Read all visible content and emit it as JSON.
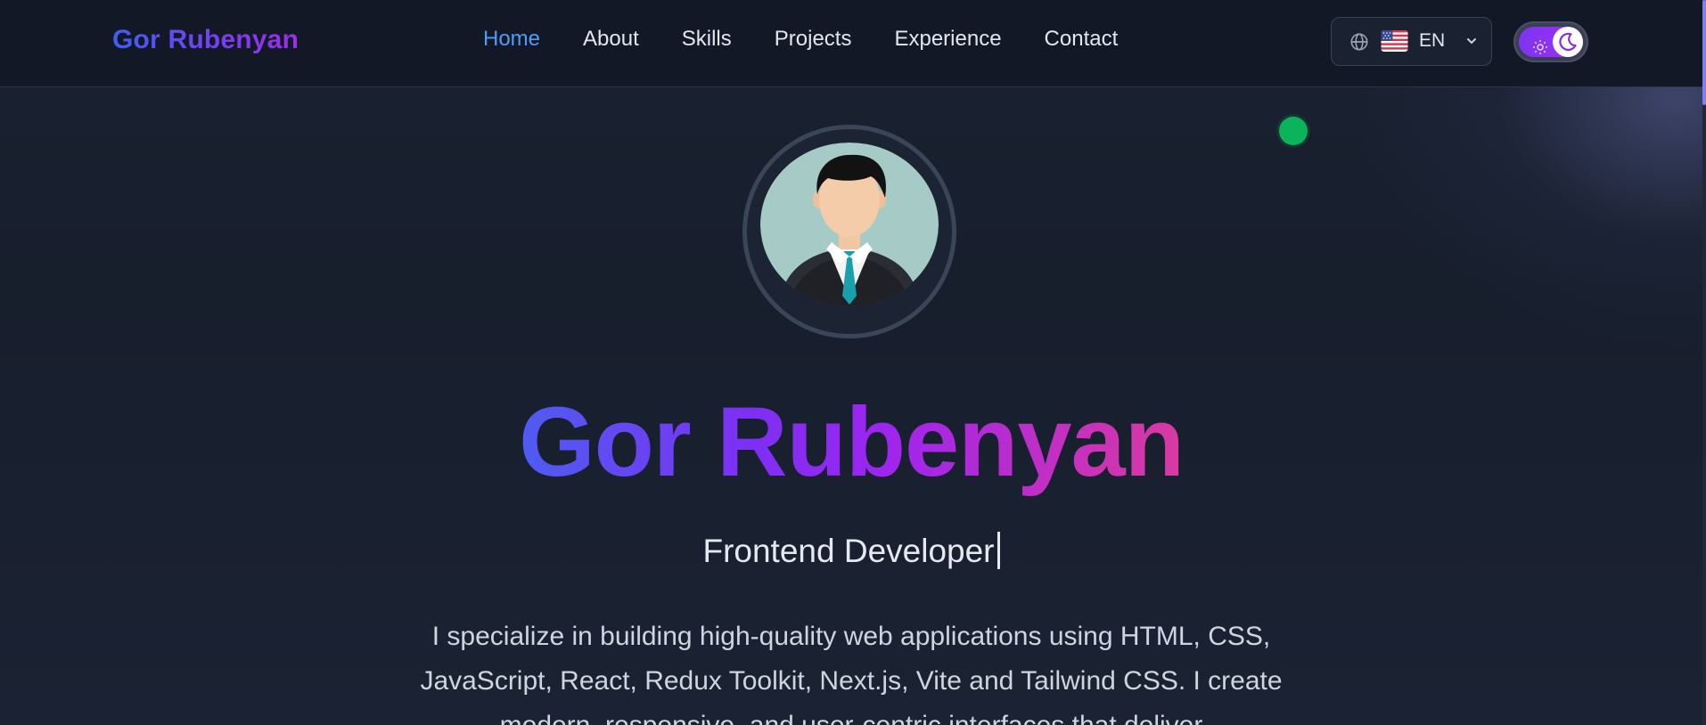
{
  "navbar": {
    "brand": "Gor Rubenyan",
    "links": [
      "Home",
      "About",
      "Skills",
      "Projects",
      "Experience",
      "Contact"
    ],
    "active_link": "Home",
    "language": {
      "code": "EN",
      "icon": "globe-icon",
      "flag": "us-flag-icon",
      "chevron": "chevron-down-icon"
    },
    "theme_toggle": {
      "mode": "dark",
      "off_icon": "sun-icon",
      "on_icon": "moon-icon"
    }
  },
  "hero": {
    "avatar": "avatar-illustration",
    "title": "Gor Rubenyan",
    "subtitle": "Frontend Developer",
    "description": "I specialize in building high-quality web applications using HTML, CSS, JavaScript, React, Redux Toolkit, Next.js, Vite and Tailwind CSS. I create modern, responsive, and user-centric interfaces that deliver"
  },
  "colors": {
    "background": "#161d2b",
    "navbar": "#121826",
    "active_link": "#4f9cf7",
    "status_dot": "#0bb35a",
    "gradient_start": "#4e5cf2",
    "gradient_mid": "#9e25ef",
    "gradient_end": "#d93aa0"
  }
}
